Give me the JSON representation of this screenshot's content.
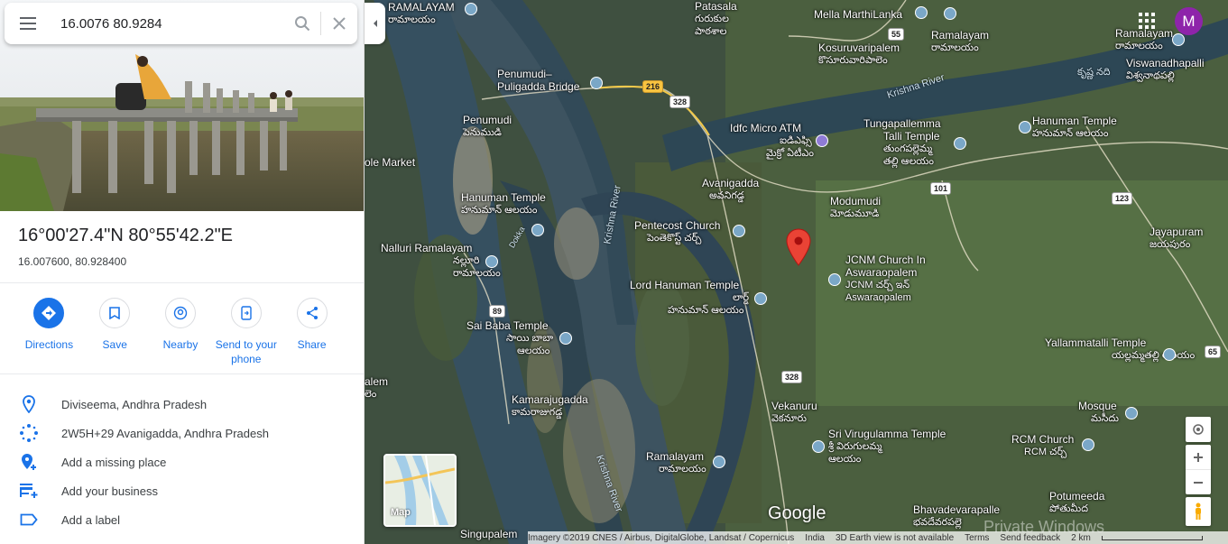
{
  "search": {
    "value": "16.0076 80.9284"
  },
  "place": {
    "title": "16°00'27.4\"N 80°55'42.2\"E",
    "decimal": "16.007600, 80.928400"
  },
  "actions": [
    {
      "label": "Directions",
      "icon": "directions-icon"
    },
    {
      "label": "Save",
      "icon": "bookmark-icon"
    },
    {
      "label": "Nearby",
      "icon": "nearby-icon"
    },
    {
      "label": "Send to your phone",
      "icon": "send-to-phone-icon"
    },
    {
      "label": "Share",
      "icon": "share-icon"
    }
  ],
  "info": [
    {
      "text": "Diviseema, Andhra Pradesh",
      "icon": "location-pin-icon"
    },
    {
      "text": "2W5H+29 Avanigadda, Andhra Pradesh",
      "icon": "plus-code-icon"
    },
    {
      "text": "Add a missing place",
      "icon": "add-place-icon"
    },
    {
      "text": "Add your business",
      "icon": "add-business-icon"
    },
    {
      "text": "Add a label",
      "icon": "label-icon"
    }
  ],
  "user": {
    "initial": "M"
  },
  "map_labels": {
    "ramalayam_top": "RAMALAYAM",
    "ramalayam_top_te": "రామాలయం",
    "patasala": "Patasala",
    "patasala_te1": "గురుకుల",
    "patasala_te2": "పాఠశాల",
    "mella": "Mella MarthiLanka",
    "penumudi_bridge1": "Penumudi–",
    "penumudi_bridge2": "Puligadda Bridge",
    "kosuru": "Kosuruvaripalem",
    "kosuru_te": "కొసూరువారిపాలెం",
    "ramalayam2": "Ramalayam",
    "ramalayam2_te": "రామాలయం",
    "ramalayam3": "Ramalayam",
    "ramalayam3_te": "రామాలయం",
    "viswa": "Viswanadhapalli",
    "viswa_te": "విశ్వనాథపల్లి",
    "krishna_nadi_te": "కృష్ణ నది",
    "krishna_river_ne": "Krishna River",
    "penumudi": "Penumudi",
    "penumudi_te": "పెనుముడి",
    "idfc": "Idfc Micro ATM",
    "idfc_te1": "ఐడిఎఫ్సి",
    "idfc_te2": "మైక్రో ఏటీఎం",
    "tungapallemma1": "Tungapallemma",
    "tungapallemma2": "Talli Temple",
    "tungapallemma_te1": "తుంగపల్లెమ్మ",
    "tungapallemma_te2": "తల్లి ఆలయం",
    "hanuman_ne": "Hanuman Temple",
    "hanuman_ne_te": "హనుమాన్ ఆలయం",
    "market": "ole Market",
    "avanigadda": "Avanigadda",
    "avanigadda_te": "అవనిగడ్డ",
    "hanuman_w": "Hanuman Temple",
    "hanuman_w_te": "హనుమాన్ ఆలయం",
    "modumudi": "Modumudi",
    "modumudi_te": "మోడుమూడి",
    "pentecost": "Pentecost Church",
    "pentecost_te": "పెంతెకొస్ట్ చర్చ్",
    "jayapuram": "Jayapuram",
    "jayapuram_te": "జయపురం",
    "nalluri": "Nalluri Ramalayam",
    "nalluri_te1": "నల్లూరి",
    "nalluri_te2": "రామాలయం",
    "jcnm1": "JCNM Church In",
    "jcnm2": "Aswaraopalem",
    "jcnm_te1": "JCNM చర్చ్ ఇన్",
    "jcnm_te2": "Aswaraopalem",
    "lord_hanuman": "Lord Hanuman Temple",
    "lord_hanuman_te1": "లార్డ్",
    "lord_hanuman_te2": "హనుమాన్ ఆలయం",
    "krishna_river_c": "Krishna River",
    "dokka": "Dokka",
    "sai_baba": "Sai Baba Temple",
    "sai_baba_te1": "సాయి బాబా",
    "sai_baba_te2": "ఆలయం",
    "yallammatalli": "Yallammatalli Temple",
    "yallammatalli_te": "యల్లమ్మతల్లి ఆలయం",
    "palem": "alem",
    "palem_te": "లెం",
    "kamarajugadda": "Kamarajugadda",
    "kamarajugadda_te": "కామరాజుగడ్డ",
    "vekanuru": "Vekanuru",
    "vekanuru_te": "వెకనూరు",
    "mosque": "Mosque",
    "mosque_te": "మసీదు",
    "srivirugulamma": "Sri Virugulamma Temple",
    "srivirugulamma_te1": "శ్రీ విరుగులమ్మ",
    "srivirugulamma_te2": "ఆలయం",
    "rcm": "RCM Church",
    "rcm_te": "RCM చర్చ్",
    "ramalayam_s": "Ramalayam",
    "ramalayam_s_te": "రామాలయం",
    "krishna_river_s": "Krishna River",
    "bhavadevarapalle": "Bhavadevarapalle",
    "bhavadevarapalle_te": "భవదేవరపల్లె",
    "potumeeda": "Potumeeda",
    "potumeeda_te": "పోతుమీద",
    "singupalem": "Singupalem"
  },
  "shields": {
    "r216": "216",
    "r328a": "328",
    "r55": "55",
    "r101": "101",
    "r123": "123",
    "r89": "89",
    "r328b": "328",
    "r65": "65"
  },
  "minimap": {
    "label": "Map"
  },
  "google_logo": "Google",
  "watermark": "Private Windows",
  "footer": {
    "imagery": "Imagery ©2019 CNES / Airbus, DigitalGlobe, Landsat / Copernicus",
    "country": "India",
    "earth": "3D Earth view is not available",
    "terms": "Terms",
    "feedback": "Send feedback",
    "scale": "2 km"
  }
}
